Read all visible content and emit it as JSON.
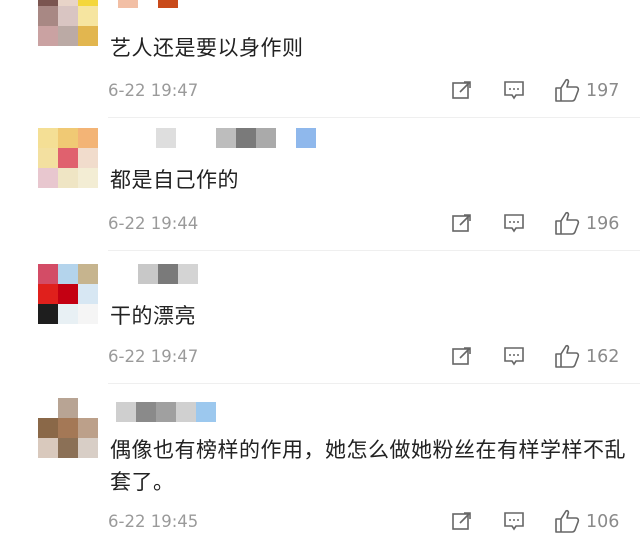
{
  "comments": [
    {
      "text": "艺人还是要以身作则",
      "time": "6-22 19:47",
      "likes": "197",
      "avatar": [
        "#7a5550",
        "#e8d4c8",
        "#f4d73c",
        "#a88884",
        "#d9c5c2",
        "#f6e5a0",
        "#caa2a2",
        "#bbaaa5",
        "#e2b64f"
      ],
      "name": [
        "#f2bfa5",
        "#ffffff",
        "#c94a1a",
        "#ffffff"
      ]
    },
    {
      "text": "都是自己作的",
      "time": "6-22 19:44",
      "likes": "196",
      "avatar": [
        "#f4df95",
        "#f0c974",
        "#f3b476",
        "#f3e0a0",
        "#e0616e",
        "#f1dccc",
        "#e8c7cf",
        "#efe5c4",
        "#f3edd4"
      ],
      "name": [
        "#ffffff",
        "#dedede",
        "#ffffff",
        "#ffffff",
        "#bdbdbd",
        "#7a7a7a",
        "#aaaaaa",
        "#ffffff",
        "#8fb8ec"
      ]
    },
    {
      "text": "干的漂亮",
      "time": "6-22 19:47",
      "likes": "162",
      "avatar": [
        "#d34c66",
        "#b4d4ec",
        "#c6b48e",
        "#e0201c",
        "#c40012",
        "#d7e7f3",
        "#1e1e1e",
        "#e8f0f4",
        "#f5f5f5"
      ],
      "name": [
        "#ffffff",
        "#c8c8c8",
        "#7a7a7a",
        "#d4d4d4"
      ]
    },
    {
      "text": "偶像也有榜样的作用，她怎么做她粉丝在有样学样不乱套了。",
      "time": "6-22 19:45",
      "likes": "106",
      "avatar": [
        "#ffffff",
        "#b8a494",
        "#ffffff",
        "#8a6848",
        "#a47856",
        "#bca08a",
        "#d9c9bd",
        "#8b7056",
        "#d8cec6"
      ],
      "name": [
        "#cfcfcf",
        "#8a8a8a",
        "#a0a0a0",
        "#d0d0d0",
        "#9cc8ee"
      ]
    }
  ]
}
